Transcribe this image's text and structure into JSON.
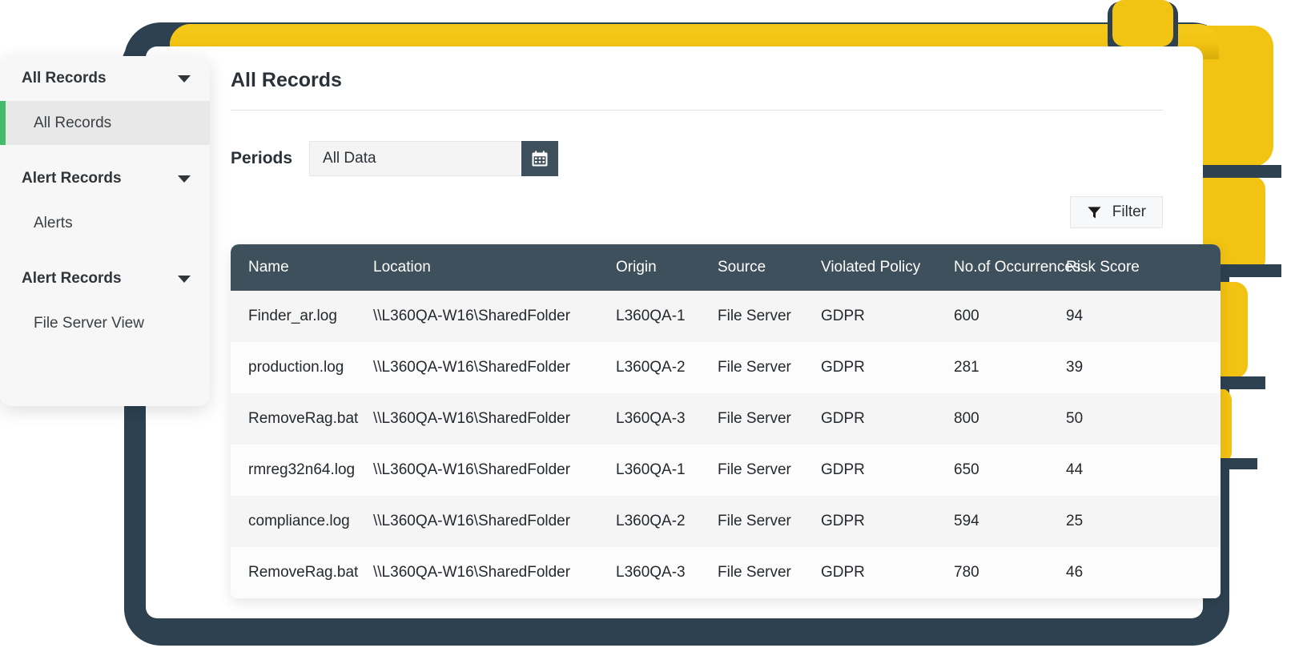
{
  "colors": {
    "yellow": "#f2c313",
    "navy": "#2d4150",
    "table_header": "#3e505c",
    "accent_green": "#43bd6b",
    "sidebar_bg": "#f7f7f7"
  },
  "sidebar": {
    "groups": [
      {
        "label": "All Records",
        "caret": "chevron-down-icon",
        "items": [
          {
            "label": "All Records",
            "active": true
          }
        ]
      },
      {
        "label": "Alert Records",
        "caret": "chevron-down-icon",
        "items": [
          {
            "label": "Alerts",
            "active": false
          }
        ]
      },
      {
        "label": "Alert Records",
        "caret": "chevron-down-icon",
        "items": [
          {
            "label": "File Server View",
            "active": false
          }
        ]
      }
    ]
  },
  "content": {
    "page_title": "All Records",
    "periods": {
      "label": "Periods",
      "value": "All Data",
      "placeholder": "All Data",
      "calendar_icon": "calendar-icon"
    },
    "filter": {
      "label": "Filter",
      "icon": "funnel-icon"
    }
  },
  "table": {
    "columns": [
      "Name",
      "Location",
      "Origin",
      "Source",
      "Violated Policy",
      "No.of Occurrences",
      "Risk Score"
    ],
    "rows": [
      {
        "name": "Finder_ar.log",
        "location": "\\\\L360QA-W16\\SharedFolder",
        "origin": "L360QA-1",
        "source": "File Server",
        "violated_policy": "GDPR",
        "occurrences": "600",
        "risk_score": "94"
      },
      {
        "name": "production.log",
        "location": "\\\\L360QA-W16\\SharedFolder",
        "origin": "L360QA-2",
        "source": "File Server",
        "violated_policy": "GDPR",
        "occurrences": "281",
        "risk_score": "39"
      },
      {
        "name": "RemoveRag.bat",
        "location": "\\\\L360QA-W16\\SharedFolder",
        "origin": "L360QA-3",
        "source": "File Server",
        "violated_policy": "GDPR",
        "occurrences": "800",
        "risk_score": "50"
      },
      {
        "name": "rmreg32n64.log",
        "location": "\\\\L360QA-W16\\SharedFolder",
        "origin": "L360QA-1",
        "source": "File Server",
        "violated_policy": "GDPR",
        "occurrences": "650",
        "risk_score": "44"
      },
      {
        "name": "compliance.log",
        "location": "\\\\L360QA-W16\\SharedFolder",
        "origin": "L360QA-2",
        "source": "File Server",
        "violated_policy": "GDPR",
        "occurrences": "594",
        "risk_score": "25"
      },
      {
        "name": "RemoveRag.bat",
        "location": "\\\\L360QA-W16\\SharedFolder",
        "origin": "L360QA-3",
        "source": "File Server",
        "violated_policy": "GDPR",
        "occurrences": "780",
        "risk_score": "46"
      }
    ]
  }
}
